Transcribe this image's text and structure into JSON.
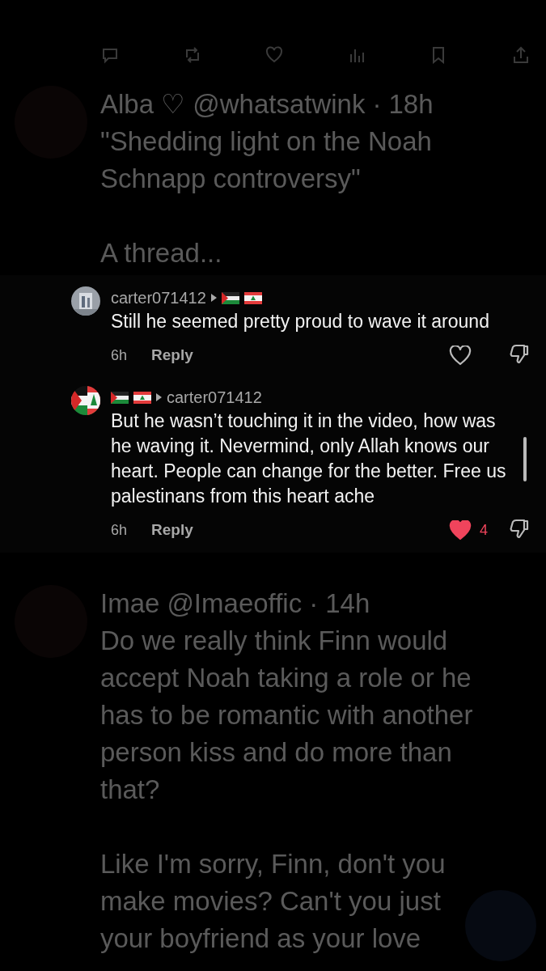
{
  "feed": [
    {
      "name": "Alba ♡",
      "handle": "@whatsatwink",
      "separator": "·",
      "time": "18h",
      "paragraphs": [
        "\"Shedding light on the Noah Schnapp controversy\"",
        "A thread..."
      ]
    },
    {
      "name": "Imae",
      "handle": "@Imaeoffic",
      "separator": "·",
      "time": "14h",
      "paragraphs": [
        "Do we really think Finn would accept Noah taking a role or he has to be romantic with another person kiss and do more than that?",
        "Like I'm sorry, Finn, don't you make movies? Can't you just your boyfriend as your love"
      ]
    }
  ],
  "comments": [
    {
      "author": {
        "kind": "text",
        "text": "carter071412"
      },
      "reply_to": {
        "kind": "flags"
      },
      "text": "Still he seemed pretty proud to wave it around",
      "time": "6h",
      "reply": "Reply",
      "liked": false
    },
    {
      "avatar": {
        "kind": "flag"
      },
      "author": {
        "kind": "flags"
      },
      "reply_to": {
        "kind": "text",
        "text": "carter071412"
      },
      "text": "But he wasn’t touching it in the video, how was he waving it. Nevermind, only Allah knows our heart. People can change for the better. Free us palestinans from this heart ache",
      "time": "6h",
      "reply": "Reply",
      "liked": true,
      "like_count": "4"
    }
  ]
}
